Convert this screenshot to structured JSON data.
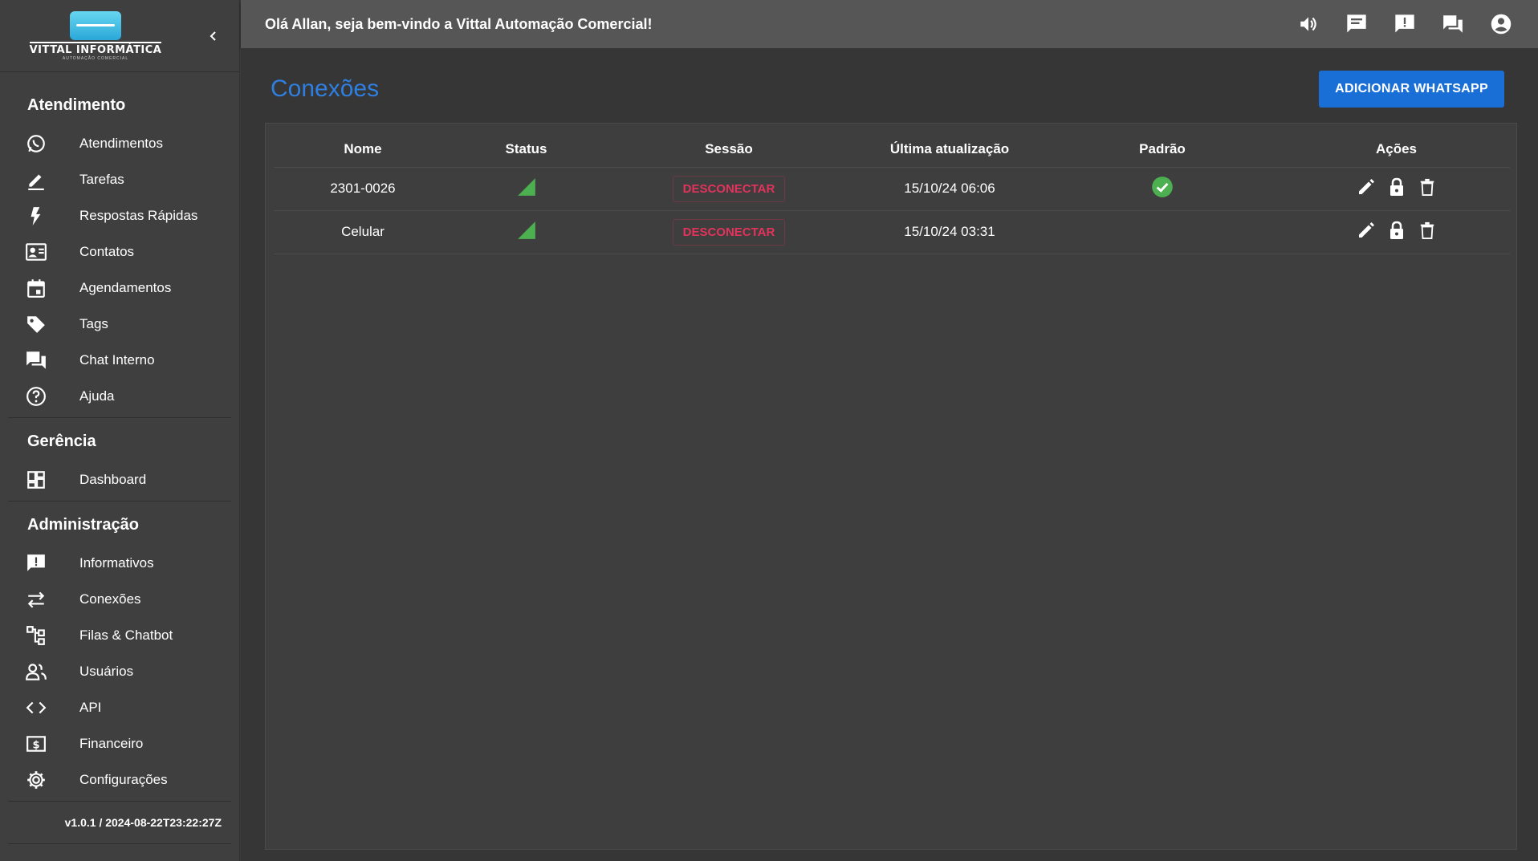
{
  "brand": {
    "name": "VITTAL INFORMÁTICA",
    "tagline": "AUTOMAÇÃO COMERCIAL"
  },
  "topbar": {
    "greeting": "Olá Allan, seja bem-vindo a Vittal Automação Comercial!"
  },
  "sidebar": {
    "sections": [
      {
        "title": "Atendimento",
        "items": [
          {
            "label": "Atendimentos",
            "icon": "whatsapp-icon"
          },
          {
            "label": "Tarefas",
            "icon": "pencil-icon"
          },
          {
            "label": "Respostas Rápidas",
            "icon": "bolt-icon"
          },
          {
            "label": "Contatos",
            "icon": "contact-card-icon"
          },
          {
            "label": "Agendamentos",
            "icon": "calendar-icon"
          },
          {
            "label": "Tags",
            "icon": "tag-icon"
          },
          {
            "label": "Chat Interno",
            "icon": "forum-icon"
          },
          {
            "label": "Ajuda",
            "icon": "help-icon"
          }
        ]
      },
      {
        "title": "Gerência",
        "items": [
          {
            "label": "Dashboard",
            "icon": "dashboard-icon"
          }
        ]
      },
      {
        "title": "Administração",
        "items": [
          {
            "label": "Informativos",
            "icon": "announcement-icon"
          },
          {
            "label": "Conexões",
            "icon": "swap-icon"
          },
          {
            "label": "Filas & Chatbot",
            "icon": "tree-icon"
          },
          {
            "label": "Usuários",
            "icon": "users-icon"
          },
          {
            "label": "API",
            "icon": "code-icon"
          },
          {
            "label": "Financeiro",
            "icon": "money-icon"
          },
          {
            "label": "Configurações",
            "icon": "gear-icon"
          }
        ]
      }
    ],
    "version": "v1.0.1 / 2024-08-22T23:22:27Z"
  },
  "page": {
    "title": "Conexões",
    "add_button": "ADICIONAR WHATSAPP"
  },
  "table": {
    "columns": [
      "Nome",
      "Status",
      "Sessão",
      "Última atualização",
      "Padrão",
      "Ações"
    ],
    "rows": [
      {
        "name": "2301-0026",
        "status": "connected",
        "session": "DESCONECTAR",
        "updated": "15/10/24 06:06",
        "default": true
      },
      {
        "name": "Celular",
        "status": "connected",
        "session": "DESCONECTAR",
        "updated": "15/10/24 03:31",
        "default": false
      }
    ]
  },
  "colors": {
    "accent": "#1a6fd6",
    "title": "#2f7fe0",
    "disconnect": "#e2335c",
    "status_ok": "#4caf50"
  }
}
